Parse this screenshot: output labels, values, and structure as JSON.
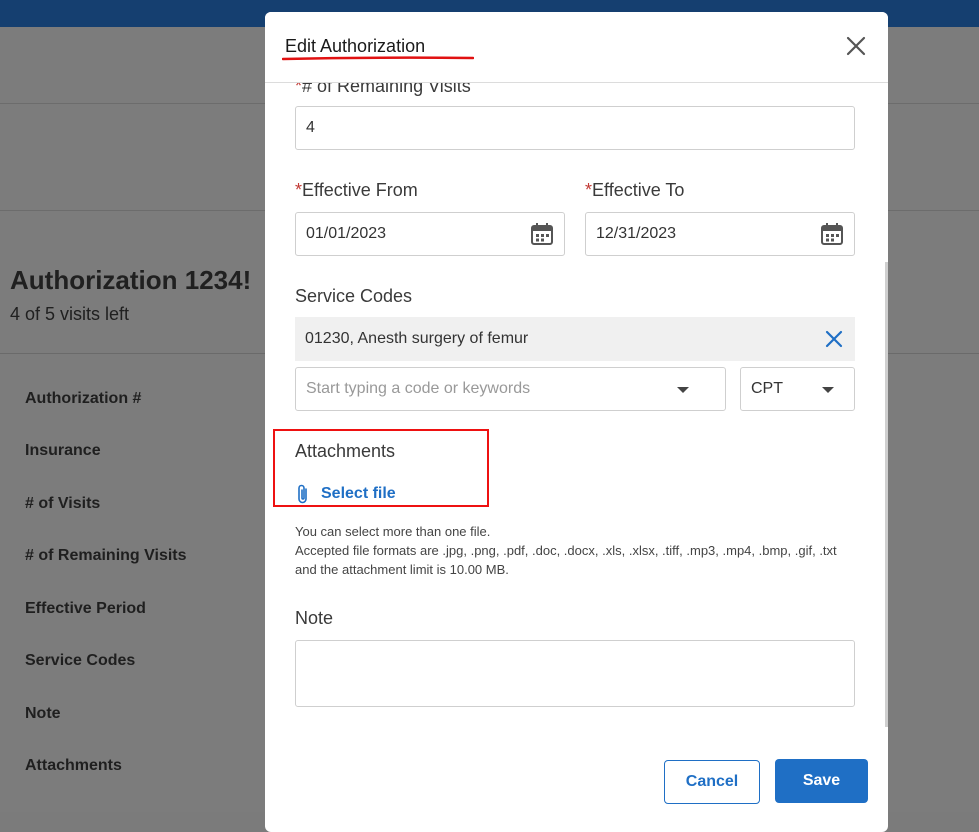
{
  "background": {
    "title": "Authorization 1234!",
    "subtitle": "4 of 5 visits left",
    "fields": [
      "Authorization #",
      "Insurance",
      "# of Visits",
      "# of Remaining Visits",
      "Effective Period",
      "Service Codes",
      "Note",
      "Attachments"
    ]
  },
  "modal": {
    "title": "Edit Authorization",
    "remaining_visits": {
      "label": "# of Remaining Visits",
      "value": "4"
    },
    "effective_from": {
      "label": "Effective From",
      "value": "01/01/2023"
    },
    "effective_to": {
      "label": "Effective To",
      "value": "12/31/2023"
    },
    "required_marker": "*",
    "service_codes": {
      "label": "Service Codes",
      "selected": "01230, Anesth surgery of femur",
      "placeholder": "Start typing a code or keywords",
      "code_type": "CPT"
    },
    "attachments": {
      "label": "Attachments",
      "select_file": "Select file",
      "help_line1": "You can select more than one file.",
      "help_line2": "Accepted file formats are .jpg, .png, .pdf, .doc, .docx, .xls, .xlsx, .tiff, .mp3, .mp4, .bmp, .gif, .txt and the attachment limit is 10.00 MB."
    },
    "note": {
      "label": "Note",
      "value": ""
    },
    "buttons": {
      "cancel": "Cancel",
      "save": "Save"
    }
  },
  "colors": {
    "accent": "#1f6fc5",
    "required": "#c23934",
    "annotation": "#e11111"
  }
}
